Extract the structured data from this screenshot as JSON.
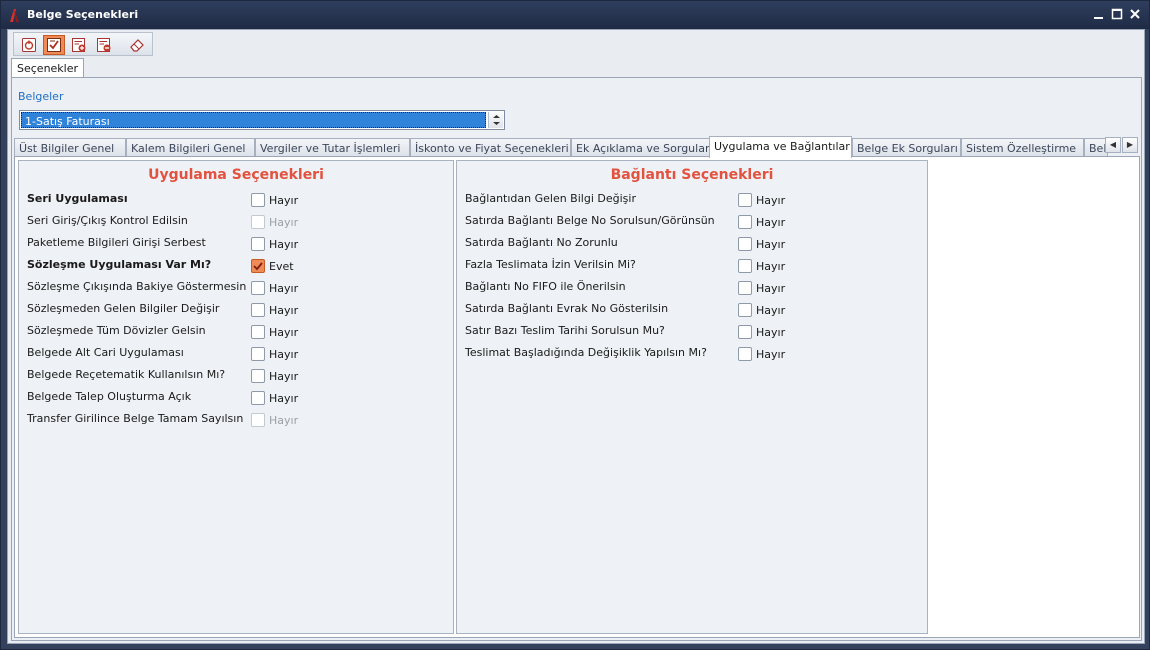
{
  "window": {
    "title": "Belge Seçenekleri"
  },
  "outer_tab": {
    "label": "Seçenekler"
  },
  "belgeler": {
    "label": "Belgeler",
    "selected": "1-Satış Faturası"
  },
  "tabs": [
    {
      "label": "Üst Bilgiler Genel"
    },
    {
      "label": "Kalem Bilgileri Genel"
    },
    {
      "label": "Vergiler ve Tutar İşlemleri"
    },
    {
      "label": "İskonto ve Fiyat Seçenekleri"
    },
    {
      "label": "Ek Açıklama ve Sorgular"
    },
    {
      "label": "Uygulama ve Bağlantılar"
    },
    {
      "label": "Belge Ek Sorguları"
    },
    {
      "label": "Sistem Özelleştirme"
    },
    {
      "label": "Bel"
    }
  ],
  "uygulama": {
    "title": "Uygulama Seçenekleri",
    "rows": [
      {
        "label": "Seri Uygulaması",
        "value": "Hayır",
        "bold": true,
        "checked": false,
        "disabled": false
      },
      {
        "label": "Seri Giriş/Çıkış Kontrol Edilsin",
        "value": "Hayır",
        "bold": false,
        "checked": false,
        "disabled": true
      },
      {
        "label": "Paketleme Bilgileri Girişi Serbest",
        "value": "Hayır",
        "bold": false,
        "checked": false,
        "disabled": false
      },
      {
        "label": "Sözleşme Uygulaması Var Mı?",
        "value": "Evet",
        "bold": true,
        "checked": true,
        "disabled": false
      },
      {
        "label": "Sözleşme Çıkışında Bakiye Göstermesin",
        "value": "Hayır",
        "bold": false,
        "checked": false,
        "disabled": false
      },
      {
        "label": "Sözleşmeden Gelen Bilgiler Değişir",
        "value": "Hayır",
        "bold": false,
        "checked": false,
        "disabled": false
      },
      {
        "label": "Sözleşmede Tüm Dövizler Gelsin",
        "value": "Hayır",
        "bold": false,
        "checked": false,
        "disabled": false
      },
      {
        "label": "Belgede Alt Cari Uygulaması",
        "value": "Hayır",
        "bold": false,
        "checked": false,
        "disabled": false
      },
      {
        "label": "Belgede Reçetematik Kullanılsın Mı?",
        "value": "Hayır",
        "bold": false,
        "checked": false,
        "disabled": false
      },
      {
        "label": "Belgede Talep Oluşturma Açık",
        "value": "Hayır",
        "bold": false,
        "checked": false,
        "disabled": false
      },
      {
        "label": "Transfer Girilince Belge Tamam Sayılsın",
        "value": "Hayır",
        "bold": false,
        "checked": false,
        "disabled": true
      }
    ]
  },
  "baglanti": {
    "title": "Bağlantı Seçenekleri",
    "rows": [
      {
        "label": "Bağlantıdan Gelen Bilgi Değişir",
        "value": "Hayır",
        "bold": false,
        "checked": false,
        "disabled": false
      },
      {
        "label": "Satırda Bağlantı Belge No Sorulsun/Görünsün",
        "value": "Hayır",
        "bold": false,
        "checked": false,
        "disabled": false
      },
      {
        "label": "Satırda Bağlantı No Zorunlu",
        "value": "Hayır",
        "bold": false,
        "checked": false,
        "disabled": false
      },
      {
        "label": "Fazla Teslimata İzin Verilsin Mi?",
        "value": "Hayır",
        "bold": false,
        "checked": false,
        "disabled": false
      },
      {
        "label": "Bağlantı No FIFO ile Önerilsin",
        "value": "Hayır",
        "bold": false,
        "checked": false,
        "disabled": false
      },
      {
        "label": "Satırda Bağlantı Evrak No Gösterilsin",
        "value": "Hayır",
        "bold": false,
        "checked": false,
        "disabled": false
      },
      {
        "label": "Satır Bazı Teslim Tarihi Sorulsun Mu?",
        "value": "Hayır",
        "bold": false,
        "checked": false,
        "disabled": false
      },
      {
        "label": "Teslimat Başladığında Değişiklik Yapılsın Mı?",
        "value": "Hayır",
        "bold": false,
        "checked": false,
        "disabled": false
      }
    ]
  },
  "colors": {
    "accent": "#f08a56",
    "title_red": "#e2523f",
    "label_blue": "#1f6fc4",
    "selection": "#2f83d8"
  }
}
